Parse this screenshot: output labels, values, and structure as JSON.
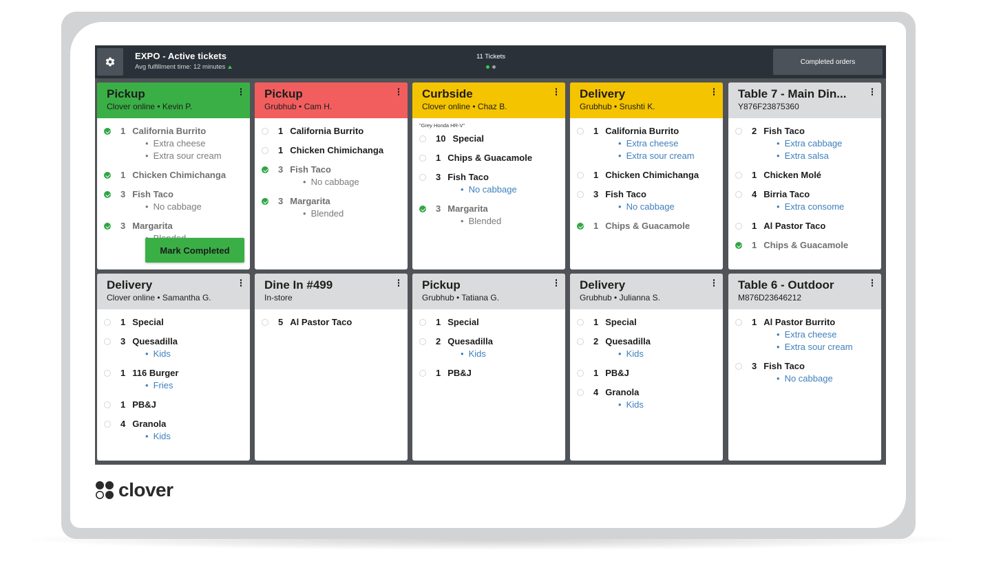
{
  "header": {
    "title": "EXPO - Active tickets",
    "subtitle": "Avg fulfillment time: 12 minutes",
    "ticket_count": "11 Tickets",
    "completed_label": "Completed orders"
  },
  "actions": {
    "mark_completed": "Mark Completed"
  },
  "logo": {
    "text": "clover"
  },
  "tickets": [
    {
      "type": "Pickup",
      "sub": "Clover online • Kevin P.",
      "color": "green",
      "items": [
        {
          "qty": "1",
          "name": "California Burrito",
          "done": true,
          "mods": [
            "Extra cheese",
            "Extra sour cream"
          ]
        },
        {
          "qty": "1",
          "name": "Chicken Chimichanga",
          "done": true,
          "mods": []
        },
        {
          "qty": "3",
          "name": "Fish Taco",
          "done": true,
          "mods": [
            "No cabbage"
          ]
        },
        {
          "qty": "3",
          "name": "Margarita",
          "done": true,
          "mods": [
            "Blended"
          ]
        }
      ]
    },
    {
      "type": "Pickup",
      "sub": "Grubhub • Cam H.",
      "color": "red",
      "items": [
        {
          "qty": "1",
          "name": "California Burrito",
          "done": false,
          "mods": []
        },
        {
          "qty": "1",
          "name": "Chicken Chimichanga",
          "done": false,
          "mods": []
        },
        {
          "qty": "3",
          "name": "Fish Taco",
          "done": true,
          "mods": [
            "No cabbage"
          ]
        },
        {
          "qty": "3",
          "name": "Margarita",
          "done": true,
          "mods": [
            "Blended"
          ]
        }
      ]
    },
    {
      "type": "Curbside",
      "sub": "Clover online • Chaz B.",
      "color": "yellow",
      "note": "\"Grey Honda HR-V\"",
      "items": [
        {
          "qty": "10",
          "name": "Special",
          "done": false,
          "mods": []
        },
        {
          "qty": "1",
          "name": "Chips & Guacamole",
          "done": false,
          "mods": []
        },
        {
          "qty": "3",
          "name": "Fish Taco",
          "done": false,
          "mods": [
            "No cabbage"
          ]
        },
        {
          "qty": "3",
          "name": "Margarita",
          "done": true,
          "mods": [
            "Blended"
          ]
        }
      ]
    },
    {
      "type": "Delivery",
      "sub": "Grubhub • Srushti K.",
      "color": "yellow",
      "items": [
        {
          "qty": "1",
          "name": "California Burrito",
          "done": false,
          "mods": [
            "Extra cheese",
            "Extra sour cream"
          ]
        },
        {
          "qty": "1",
          "name": "Chicken Chimichanga",
          "done": false,
          "mods": []
        },
        {
          "qty": "3",
          "name": "Fish Taco",
          "done": false,
          "mods": [
            "No cabbage"
          ]
        },
        {
          "qty": "1",
          "name": "Chips & Guacamole",
          "done": true,
          "mods": []
        }
      ]
    },
    {
      "type": "Table 7 - Main Din...",
      "sub": "Y876F23875360",
      "color": "gray",
      "items": [
        {
          "qty": "2",
          "name": "Fish Taco",
          "done": false,
          "mods": [
            "Extra cabbage",
            "Extra salsa"
          ]
        },
        {
          "qty": "1",
          "name": "Chicken Molé",
          "done": false,
          "mods": []
        },
        {
          "qty": "4",
          "name": "Birria Taco",
          "done": false,
          "mods": [
            "Extra consome"
          ]
        },
        {
          "qty": "1",
          "name": "Al Pastor Taco",
          "done": false,
          "mods": []
        },
        {
          "qty": "1",
          "name": "Chips & Guacamole",
          "done": true,
          "mods": []
        }
      ]
    },
    {
      "type": "Delivery",
      "sub": "Clover online • Samantha G.",
      "color": "gray",
      "items": [
        {
          "qty": "1",
          "name": "Special",
          "done": false,
          "mods": []
        },
        {
          "qty": "3",
          "name": "Quesadilla",
          "done": false,
          "mods": [
            "Kids"
          ]
        },
        {
          "qty": "1",
          "name": "116 Burger",
          "done": false,
          "mods": [
            "Fries"
          ]
        },
        {
          "qty": "1",
          "name": "PB&J",
          "done": false,
          "mods": []
        },
        {
          "qty": "4",
          "name": "Granola",
          "done": false,
          "mods": [
            "Kids"
          ]
        }
      ]
    },
    {
      "type": "Dine In #499",
      "sub": "In-store",
      "color": "gray",
      "items": [
        {
          "qty": "5",
          "name": "Al Pastor Taco",
          "done": false,
          "mods": []
        }
      ]
    },
    {
      "type": "Pickup",
      "sub": "Grubhub • Tatiana G.",
      "color": "gray",
      "items": [
        {
          "qty": "1",
          "name": "Special",
          "done": false,
          "mods": []
        },
        {
          "qty": "2",
          "name": "Quesadilla",
          "done": false,
          "mods": [
            "Kids"
          ]
        },
        {
          "qty": "1",
          "name": "PB&J",
          "done": false,
          "mods": []
        }
      ]
    },
    {
      "type": "Delivery",
      "sub": "Grubhub • Julianna S.",
      "color": "gray",
      "items": [
        {
          "qty": "1",
          "name": "Special",
          "done": false,
          "mods": []
        },
        {
          "qty": "2",
          "name": "Quesadilla",
          "done": false,
          "mods": [
            "Kids"
          ]
        },
        {
          "qty": "1",
          "name": "PB&J",
          "done": false,
          "mods": []
        },
        {
          "qty": "4",
          "name": "Granola",
          "done": false,
          "mods": [
            "Kids"
          ]
        }
      ]
    },
    {
      "type": "Table 6 - Outdoor",
      "sub": "M876D23646212",
      "color": "gray",
      "items": [
        {
          "qty": "1",
          "name": "Al Pastor Burrito",
          "done": false,
          "mods": [
            "Extra cheese",
            "Extra sour cream"
          ]
        },
        {
          "qty": "3",
          "name": "Fish Taco",
          "done": false,
          "mods": [
            "No cabbage"
          ]
        }
      ]
    }
  ]
}
